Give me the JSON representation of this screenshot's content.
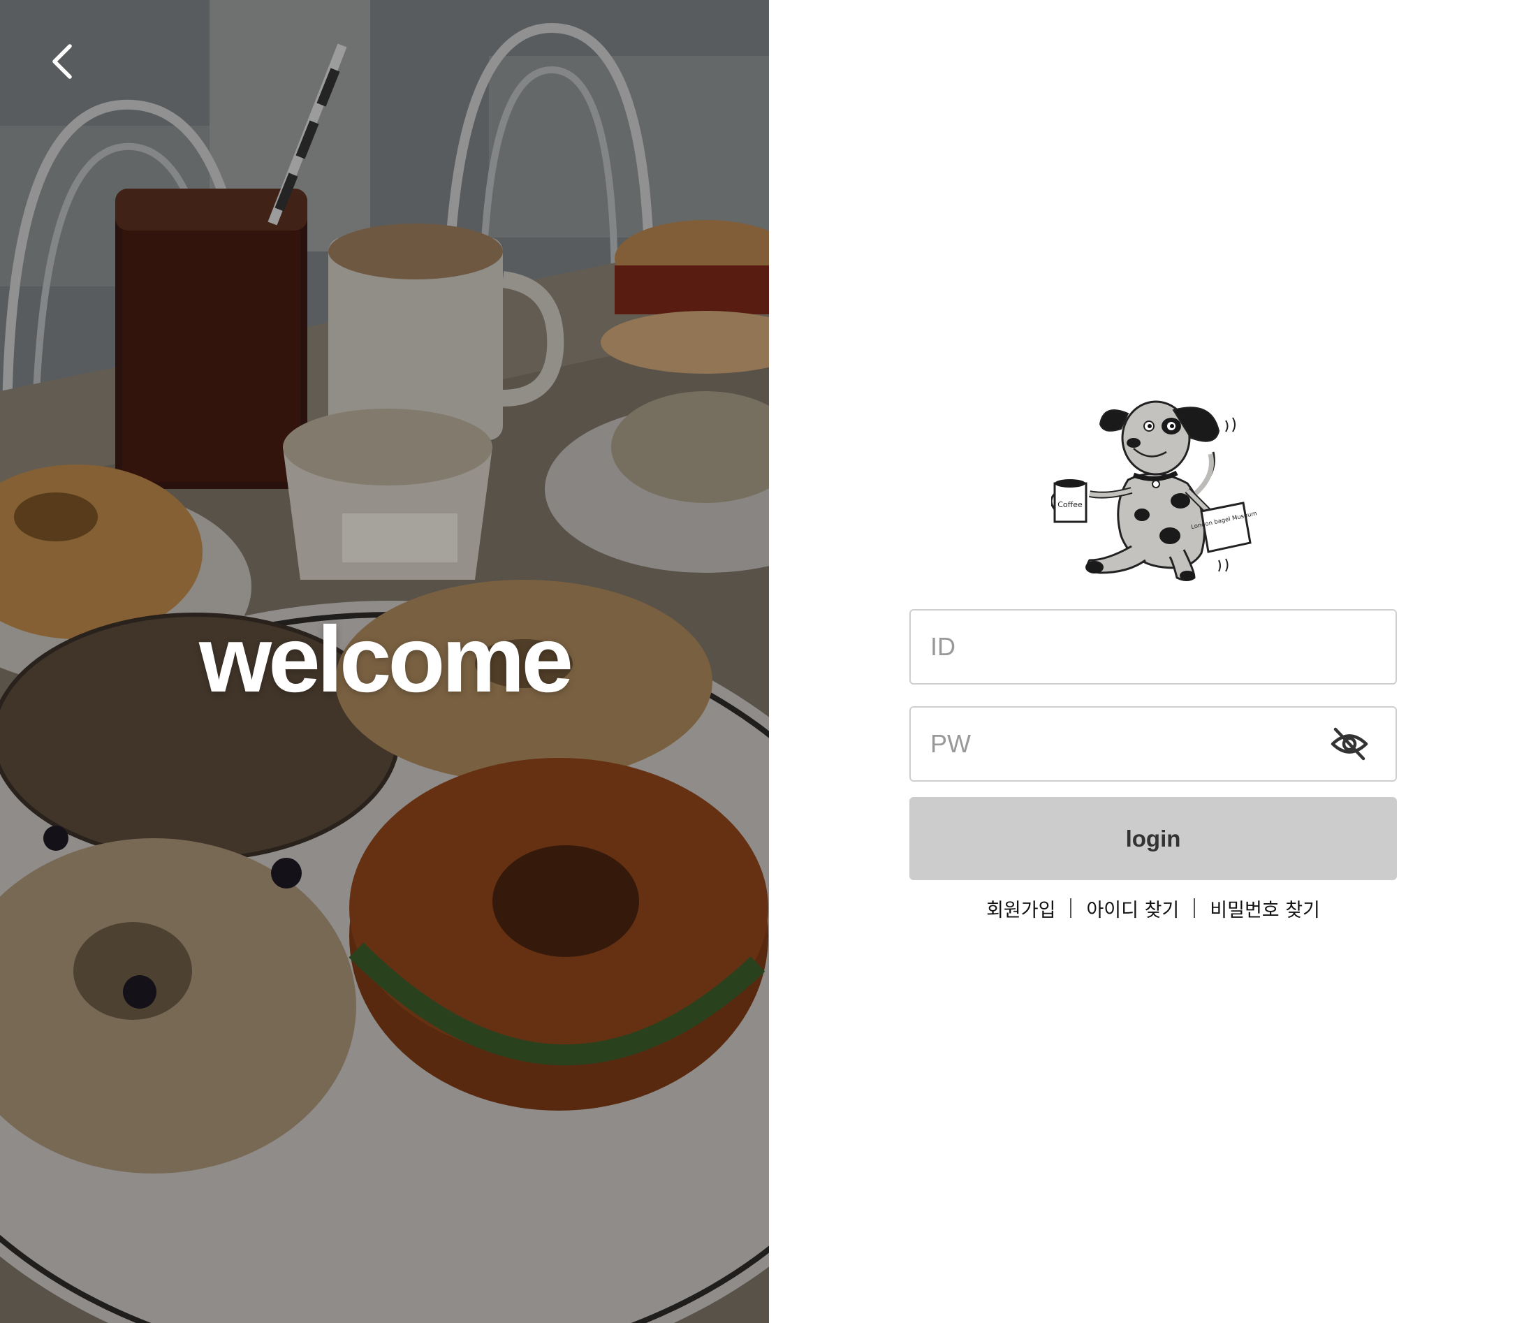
{
  "hero": {
    "title": "welcome",
    "back_icon": "chevron-left-icon"
  },
  "login_form": {
    "id_placeholder": "ID",
    "id_value": "",
    "pw_placeholder": "PW",
    "pw_value": "",
    "pw_toggle_icon": "eye-off-icon",
    "login_label": "login",
    "login_button_color": "#cccccc"
  },
  "links": {
    "signup": "회원가입",
    "find_id": "아이디 찾기",
    "find_pw": "비밀번호 찾기"
  },
  "mascot": {
    "cup_text": "Coffee",
    "bag_text": "London bagel Museum"
  }
}
